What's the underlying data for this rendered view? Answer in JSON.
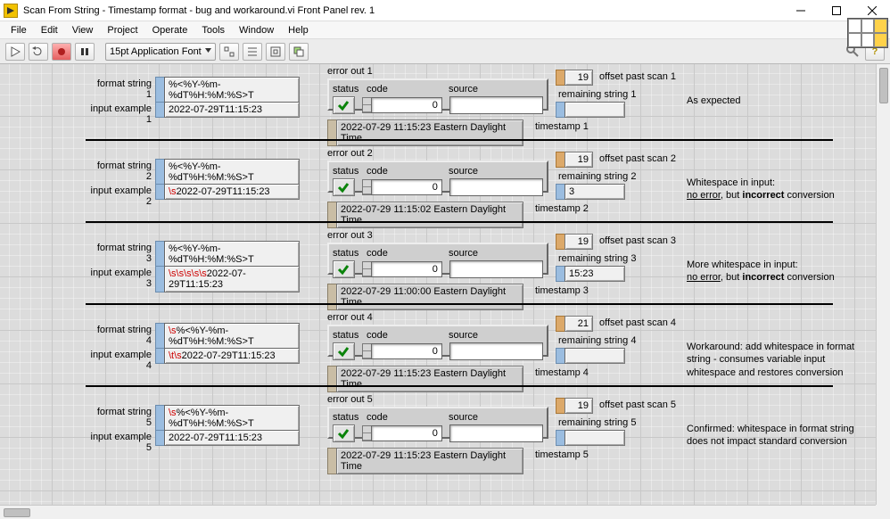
{
  "window": {
    "title": "Scan From String - Timestamp format - bug and workaround.vi Front Panel rev. 1"
  },
  "menu": {
    "items": [
      "File",
      "Edit",
      "View",
      "Project",
      "Operate",
      "Tools",
      "Window",
      "Help"
    ]
  },
  "toolbar": {
    "font": "15pt Application Font"
  },
  "rows": [
    {
      "fmt_label": "format string 1",
      "fmt": "%<%Y-%m-%dT%H:%M:%S>T",
      "inp_label": "input example 1",
      "inp": "2022-07-29T11:15:23",
      "inp_pre": "",
      "err_title": "error out 1",
      "status_hdr": "status",
      "code_hdr": "code",
      "source_hdr": "source",
      "code": "0",
      "ts": "2022-07-29 11:15:23 Eastern Daylight Time",
      "ts_label": "timestamp 1",
      "offset": "19",
      "offset_label": "offset past scan 1",
      "rem_label": "remaining string 1",
      "rem": "",
      "comment": "As expected"
    },
    {
      "fmt_label": "format string 2",
      "fmt": "%<%Y-%m-%dT%H:%M:%S>T",
      "inp_label": "input example 2",
      "inp": "2022-07-29T11:15:23",
      "inp_pre": "\\s",
      "err_title": "error out 2",
      "status_hdr": "status",
      "code_hdr": "code",
      "source_hdr": "source",
      "code": "0",
      "ts": "2022-07-29 11:15:02 Eastern Daylight Time",
      "ts_label": "timestamp 2",
      "offset": "19",
      "offset_label": "offset past scan 2",
      "rem_label": "remaining string 2",
      "rem": "3",
      "comment": "Whitespace in input:<br><u>no error</u>, but <b>incorrect</b> conversion"
    },
    {
      "fmt_label": "format string 3",
      "fmt": "%<%Y-%m-%dT%H:%M:%S>T",
      "inp_label": "input example 3",
      "inp": "2022-07-29T11:15:23",
      "inp_pre": "\\s\\s\\s\\s\\s",
      "err_title": "error out 3",
      "status_hdr": "status",
      "code_hdr": "code",
      "source_hdr": "source",
      "code": "0",
      "ts": "2022-07-29 11:00:00 Eastern Daylight Time",
      "ts_label": "timestamp 3",
      "offset": "19",
      "offset_label": "offset past scan 3",
      "rem_label": "remaining string 3",
      "rem": "15:23",
      "comment": "More whitespace in input:<br><u>no error</u>, but <b>incorrect</b> conversion"
    },
    {
      "fmt_label": "format string 4",
      "fmt": "%<%Y-%m-%dT%H:%M:%S>T",
      "fmt_pre": "\\s",
      "inp_label": "input example 4",
      "inp": "2022-07-29T11:15:23",
      "inp_pre": "\\t\\s",
      "err_title": "error out 4",
      "status_hdr": "status",
      "code_hdr": "code",
      "source_hdr": "source",
      "code": "0",
      "ts": "2022-07-29 11:15:23 Eastern Daylight Time",
      "ts_label": "timestamp 4",
      "offset": "21",
      "offset_label": "offset past scan 4",
      "rem_label": "remaining string 4",
      "rem": "",
      "comment": "Workaround: add whitespace in format string - consumes variable input whitespace and restores conversion"
    },
    {
      "fmt_label": "format string 5",
      "fmt": "%<%Y-%m-%dT%H:%M:%S>T",
      "fmt_pre": "\\s",
      "inp_label": "input example 5",
      "inp": "2022-07-29T11:15:23",
      "inp_pre": "",
      "err_title": "error out 5",
      "status_hdr": "status",
      "code_hdr": "code",
      "source_hdr": "source",
      "code": "0",
      "ts": "2022-07-29 11:15:23 Eastern Daylight Time",
      "ts_label": "timestamp 5",
      "offset": "19",
      "offset_label": "offset past scan 5",
      "rem_label": "remaining string 5",
      "rem": "",
      "comment": "Confirmed: whitespace in format string does not impact standard conversion"
    }
  ]
}
